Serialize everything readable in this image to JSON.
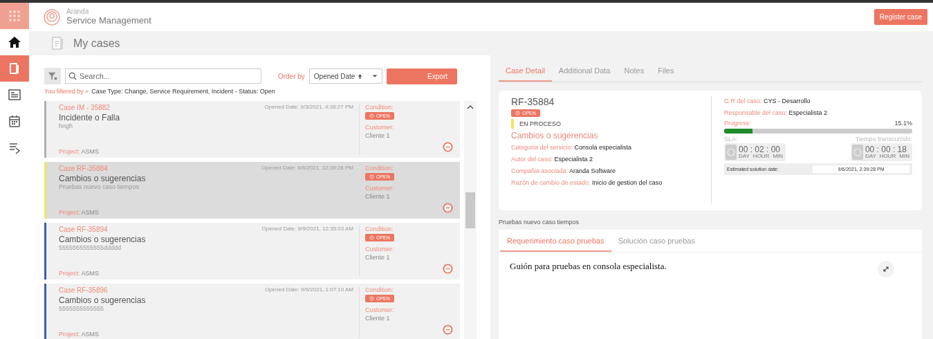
{
  "header": {
    "brand_top": "Aranda",
    "brand_bottom": "Service Management",
    "register_button": "Register case"
  },
  "sidebar": {
    "items": [
      {
        "kind": "apps",
        "selected": false
      },
      {
        "kind": "home",
        "selected": false
      },
      {
        "kind": "cases",
        "selected": true
      },
      {
        "kind": "news",
        "selected": false
      },
      {
        "kind": "calendar",
        "selected": false
      },
      {
        "kind": "transfer",
        "selected": false
      }
    ]
  },
  "page_title": "My cases",
  "toolbar": {
    "search": {
      "placeholder": "Search..."
    },
    "order_label": "Order by",
    "order_value": "Opened Date",
    "export_button": "Export"
  },
  "filter": {
    "label": "You filtered by »",
    "text": "Case Type: Change, Service Requirement, Incident - Status: Open"
  },
  "cases": [
    {
      "id": "Case IM - 35882",
      "opened": "Opened Date: 9/3/2021, 4:38:27 PM",
      "title": "Incidente o Falla",
      "description": "hngh",
      "project_label": "Project:",
      "project": "ASMS",
      "condition_label": "Condition:",
      "status": "OPEN",
      "customer_label": "Customer:",
      "customer": "Cliente 1",
      "color": "#b0b0b0",
      "selected": false
    },
    {
      "id": "Case RF-35884",
      "opened": "Opened Date: 9/6/2021, 12:39:28 PM",
      "title": "Cambios o sugerencias",
      "description": "Pruebas nuevo caso tiempos",
      "project_label": "Project:",
      "project": "ASMS",
      "condition_label": "Condition:",
      "status": "OPEN",
      "customer_label": "Customer:",
      "customer": "Cliente 1",
      "color": "#f0e65a",
      "selected": true
    },
    {
      "id": "Case RF-35894",
      "opened": "Opened Date: 9/9/2021, 12:35:03 AM",
      "title": "Cambios o sugerencias",
      "description": "5555555555555ddddd",
      "project_label": "Project:",
      "project": "ASMS",
      "condition_label": "Condition:",
      "status": "OPEN",
      "customer_label": "Customer:",
      "customer": "Cliente 1",
      "color": "#3b5ea6",
      "selected": false
    },
    {
      "id": "Case RF-35896",
      "opened": "Opened Date: 9/9/2021, 1:07:10 AM",
      "title": "Cambios o sugerencias",
      "description": "5555555555555",
      "project_label": "Project:",
      "project": "ASMS",
      "condition_label": "Condition:",
      "status": "OPEN",
      "customer_label": "Customer:",
      "customer": "Cliente 1",
      "color": "#3b5ea6",
      "selected": false
    }
  ],
  "detail": {
    "tabs": [
      {
        "label": "Case Detail",
        "selected": true
      },
      {
        "label": "Additional Data",
        "selected": false
      },
      {
        "label": "Notes",
        "selected": false
      },
      {
        "label": "Files",
        "selected": false
      }
    ],
    "case_id": "RF-35884",
    "status": "OPEN",
    "state": {
      "text": "EN PROCESO",
      "color": "#f0e65a"
    },
    "title": "Cambios o sugerencias",
    "fields": [
      {
        "label": "Categoria del servicio:",
        "value": "Consola especialista"
      },
      {
        "label": "Autor del caso:",
        "value": "Especialista 2"
      },
      {
        "label": "Compañia asociada:",
        "value": "Aranda Software"
      },
      {
        "label": "Razón de cambio de estado:",
        "value": "Inicio de gestion del caso"
      }
    ],
    "right_fields": [
      {
        "label": "G R del caso:",
        "value": "CYS - Desarrollo"
      },
      {
        "label": "Responsable del caso:",
        "value": "Especialista 2"
      }
    ],
    "progress": {
      "label": "Progress:",
      "reading": "15.1%",
      "level": 0.151
    },
    "timers": [
      {
        "label": "SLA:",
        "digits": "00 : 02 : 00",
        "units": [
          "DAY",
          "HOUR",
          "MIN"
        ]
      },
      {
        "label": "Tiempo transcurrido:",
        "digits": "00 : 00 : 18",
        "units": [
          "DAY",
          "HOUR",
          "MIN"
        ]
      }
    ],
    "estimated": {
      "label": "Estimated solution date:",
      "value": "9/6/2021, 2:39:28 PM"
    }
  },
  "description": {
    "title": "Pruebas nuevo caso tiempos",
    "tabs": [
      {
        "label": "Requerimiento caso pruebas",
        "selected": true
      },
      {
        "label": "Solución caso pruebas",
        "selected": false
      }
    ],
    "text": "Guión para pruebas en consola especialista."
  }
}
